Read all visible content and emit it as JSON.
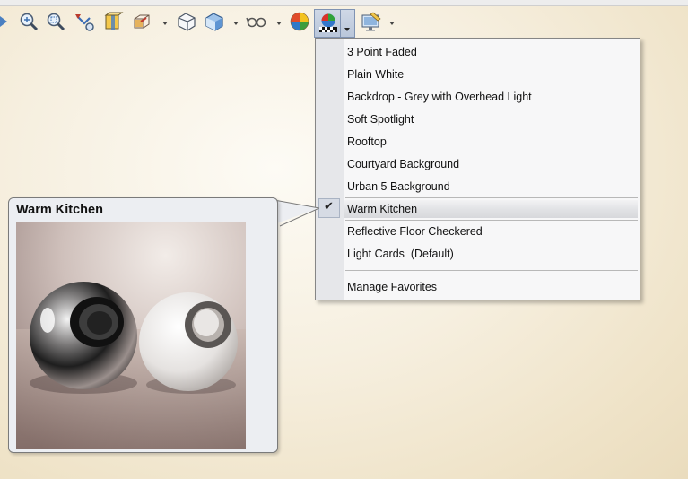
{
  "toolbar": {
    "icons": [
      "view-triangle-icon",
      "zoom-to-fit-icon",
      "zoom-to-area-icon",
      "previous-view-icon",
      "section-view-icon",
      "view-orientation-icon",
      "display-style-icon",
      "shaded-box-icon",
      "hide-show-items-icon",
      "edit-appearance-icon",
      "apply-scene-icon",
      "view-settings-icon"
    ]
  },
  "menu": {
    "items": [
      {
        "label": "3 Point Faded"
      },
      {
        "label": "Plain White"
      },
      {
        "label": "Backdrop - Grey with Overhead Light"
      },
      {
        "label": "Soft Spotlight"
      },
      {
        "label": "Rooftop"
      },
      {
        "label": "Courtyard Background"
      },
      {
        "label": "Urban 5 Background"
      },
      {
        "label": "Warm Kitchen",
        "checked": true
      },
      {
        "label": "Reflective Floor Checkered"
      },
      {
        "label": "Light Cards  (Default)"
      },
      {
        "label": "Manage Favorites"
      }
    ]
  },
  "tooltip": {
    "title": "Warm Kitchen"
  },
  "colors": {
    "menu_bg": "#f7f7f8",
    "gutter": "#e6e7ea",
    "tooltip_bg": "#eceef2"
  }
}
